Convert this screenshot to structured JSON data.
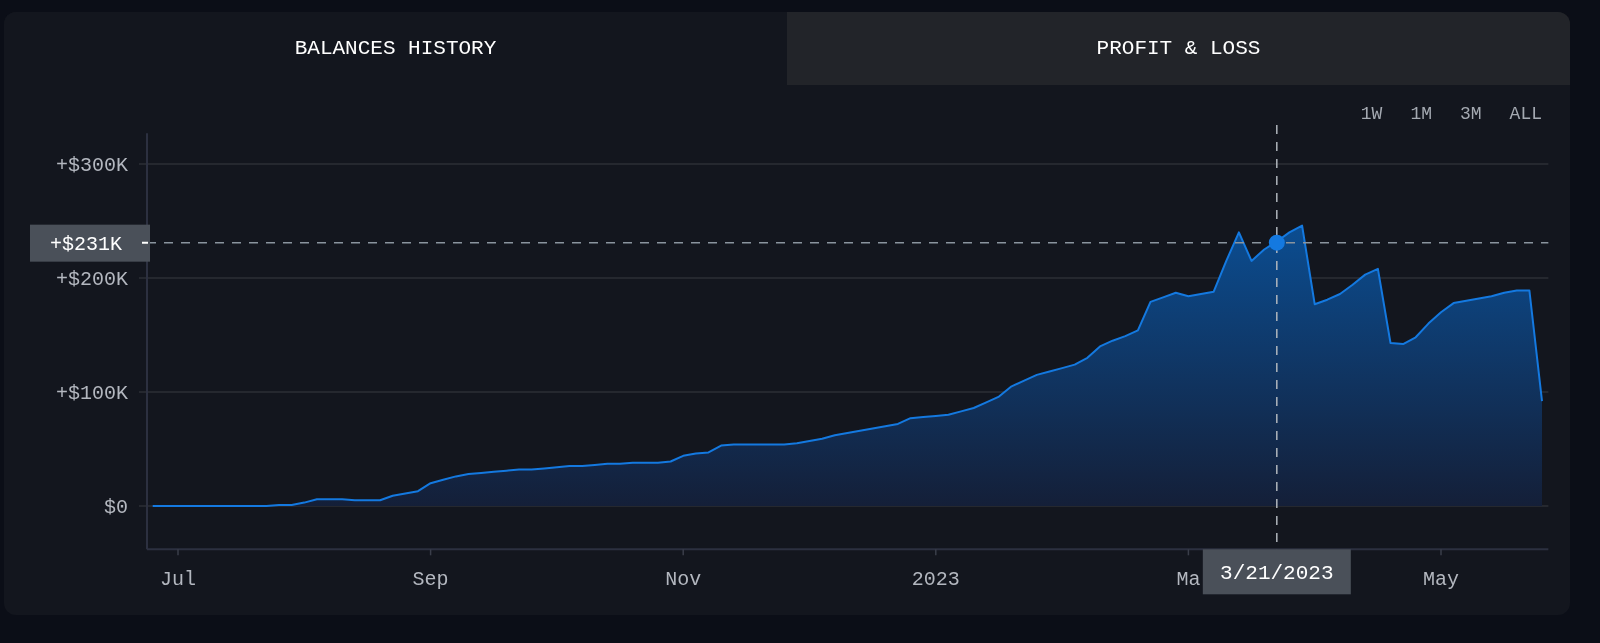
{
  "tabs": [
    {
      "label": "BALANCES HISTORY",
      "selected": true
    },
    {
      "label": "PROFIT & LOSS",
      "selected": false
    }
  ],
  "ranges": [
    {
      "label": "1W",
      "selected": false
    },
    {
      "label": "1M",
      "selected": false
    },
    {
      "label": "3M",
      "selected": false
    },
    {
      "label": "ALL",
      "selected": false
    }
  ],
  "chart_data": {
    "type": "area",
    "grid": true,
    "ylim": [
      -38,
      327
    ],
    "categories": [
      null,
      null,
      "Jul",
      null,
      null,
      null,
      null,
      null,
      null,
      null,
      null,
      null,
      null,
      null,
      null,
      null,
      null,
      null,
      null,
      null,
      null,
      null,
      "Sep",
      null,
      null,
      null,
      null,
      null,
      null,
      null,
      null,
      null,
      null,
      null,
      null,
      null,
      null,
      null,
      null,
      null,
      null,
      null,
      "Nov",
      null,
      null,
      null,
      null,
      null,
      null,
      null,
      null,
      null,
      null,
      null,
      null,
      null,
      null,
      null,
      null,
      null,
      null,
      null,
      "2023",
      null,
      null,
      null,
      null,
      null,
      null,
      null,
      null,
      null,
      null,
      null,
      null,
      null,
      null,
      null,
      null,
      null,
      null,
      null,
      "Ma",
      null,
      null,
      null,
      null,
      null,
      null,
      "3/21/2023",
      null,
      null,
      null,
      null,
      null,
      null,
      null,
      null,
      null,
      null,
      null,
      null,
      "May",
      null,
      null,
      null,
      null,
      null,
      null,
      null,
      null
    ],
    "yticks": [
      {
        "value": 0,
        "label": "$0"
      },
      {
        "value": 100,
        "label": "+$100K"
      },
      {
        "value": 200,
        "label": "+$200K"
      },
      {
        "value": 300,
        "label": "+$300K"
      }
    ],
    "series": [
      {
        "color": "#1479e0",
        "values": [
          0,
          0,
          0,
          0,
          0,
          0,
          0,
          0,
          0,
          0,
          1,
          1,
          3,
          6,
          6,
          6,
          5,
          5,
          5,
          9,
          11,
          13,
          20,
          23,
          26,
          28,
          29,
          30,
          31,
          32,
          32,
          33,
          34,
          35,
          35,
          36,
          37,
          37,
          38,
          38,
          38,
          39,
          44,
          46,
          47,
          53,
          54,
          54,
          54,
          54,
          54,
          55,
          57,
          59,
          62,
          64,
          66,
          68,
          70,
          72,
          77,
          78,
          79,
          80,
          83,
          86,
          91,
          96,
          105,
          110,
          115,
          118,
          121,
          124,
          130,
          140,
          145,
          149,
          154,
          179,
          183,
          187,
          184,
          186,
          188,
          215,
          240,
          215,
          225,
          232,
          240,
          246,
          177,
          181,
          186,
          194,
          203,
          208,
          143,
          142,
          148,
          160,
          170,
          178,
          180,
          182,
          184,
          187,
          189,
          189,
          92
        ]
      }
    ],
    "ref_lines": [
      {
        "axis": "x",
        "value": "3/21/2023"
      },
      {
        "axis": "y",
        "value": 231,
        "label": "+$231K"
      }
    ]
  }
}
